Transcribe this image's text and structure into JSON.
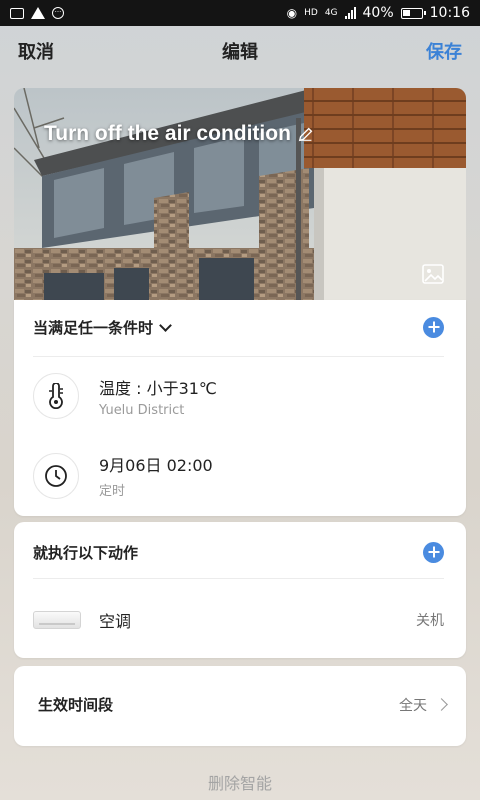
{
  "status_bar": {
    "signal_label": "4G",
    "hd_label": "HD",
    "battery_percent": "40%",
    "time": "10:16"
  },
  "nav": {
    "cancel_label": "取消",
    "title": "编辑",
    "save_label": "保存"
  },
  "banner": {
    "scene_name": "Turn off the air condition"
  },
  "conditions": {
    "header": "当满足任一条件时",
    "items": [
      {
        "icon": "thermometer-icon",
        "title": "温度 : 小于31℃",
        "subtitle": "Yuelu District"
      },
      {
        "icon": "clock-icon",
        "title": "9月06日  02:00",
        "subtitle": "定时"
      }
    ]
  },
  "actions": {
    "header": "就执行以下动作",
    "items": [
      {
        "icon": "air-conditioner-thumbnail",
        "label": "空调",
        "status": "关机"
      }
    ]
  },
  "effective_period": {
    "label": "生效时间段",
    "value": "全天"
  },
  "delete_label": "删除智能",
  "colors": {
    "accent": "#3b82d6",
    "plus_button": "#4a8be0",
    "status_bar": "#141414"
  }
}
